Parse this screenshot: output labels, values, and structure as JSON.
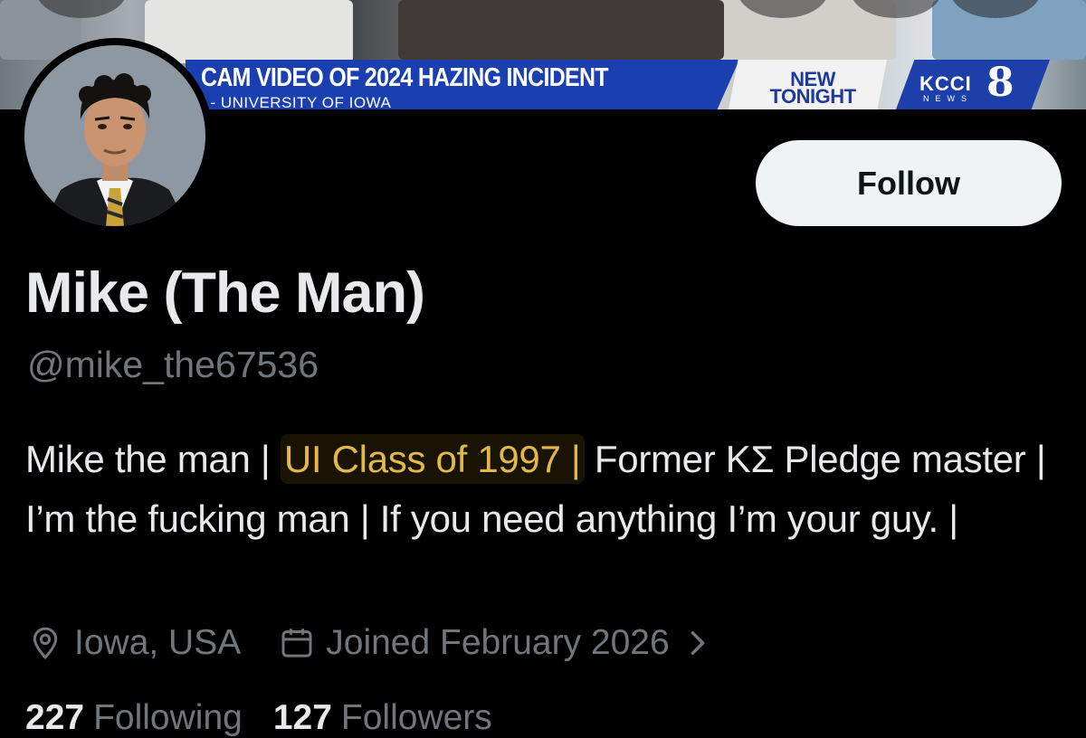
{
  "banner": {
    "headline": "CAM VIDEO OF 2024 HAZING INCIDENT",
    "subline": "I - UNIVERSITY OF IOWA",
    "badge_line1": "NEW",
    "badge_line2": "TONIGHT",
    "station_name": "KCCI",
    "station_number": "8",
    "station_sub": "NEWS",
    "ticker_color": "#1a3fb0"
  },
  "profile": {
    "display_name": "Mike (The Man)",
    "handle": "@mike_the67536",
    "follow_label": "Follow",
    "bio": {
      "part1": "Mike the man | ",
      "highlight": "UI Class of 1997 |",
      "part2": " Former ΚΣ Pledge master | I’m the fucking man | If you need anything I’m your guy. |"
    },
    "location": "Iowa, USA",
    "joined": "Joined February 2026",
    "location_icon": "location-pin-icon",
    "calendar_icon": "calendar-icon"
  },
  "stats": {
    "following_count": "227",
    "following_label": "Following",
    "followers_count": "127",
    "followers_label": "Followers"
  },
  "colors": {
    "background": "#000000",
    "text_primary": "#e7e9ea",
    "text_secondary": "#71767b",
    "highlight": "#e3b84a",
    "button_bg": "#eff3f4"
  }
}
